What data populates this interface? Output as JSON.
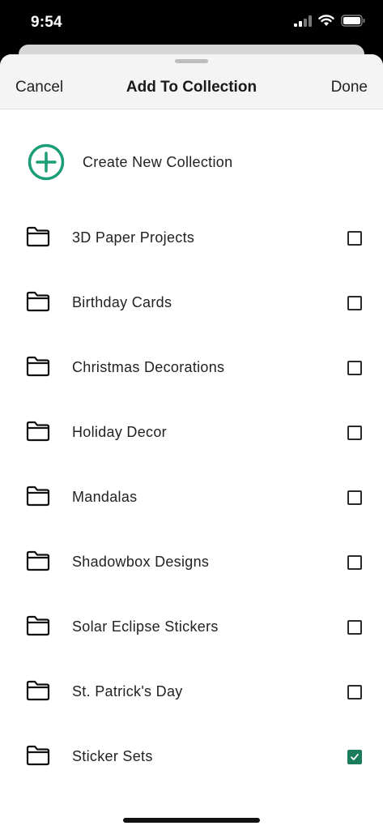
{
  "status_bar": {
    "time": "9:54"
  },
  "nav": {
    "cancel": "Cancel",
    "title": "Add To Collection",
    "done": "Done"
  },
  "create": {
    "label": "Create New Collection"
  },
  "colors": {
    "accent": "#1b9e77",
    "check": "#1b7d5e"
  },
  "collections": [
    {
      "label": "3D Paper Projects",
      "checked": false
    },
    {
      "label": "Birthday Cards",
      "checked": false
    },
    {
      "label": "Christmas Decorations",
      "checked": false
    },
    {
      "label": "Holiday Decor",
      "checked": false
    },
    {
      "label": "Mandalas",
      "checked": false
    },
    {
      "label": "Shadowbox Designs",
      "checked": false
    },
    {
      "label": "Solar Eclipse Stickers",
      "checked": false
    },
    {
      "label": "St. Patrick's Day",
      "checked": false
    },
    {
      "label": "Sticker Sets",
      "checked": true
    }
  ]
}
